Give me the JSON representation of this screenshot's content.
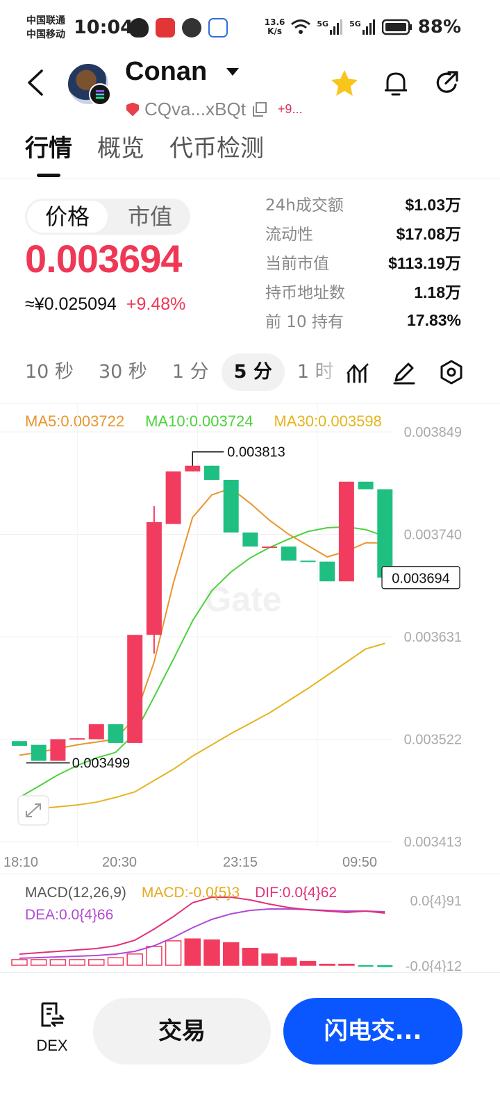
{
  "status_bar": {
    "carrier_1": "中国联通",
    "carrier_2": "中国移动",
    "time": "10:04",
    "net_speed_value": "13.6",
    "net_speed_unit": "K/s",
    "net_type_1": "5G",
    "net_type_2": "5G",
    "battery": "88%",
    "app_icons": [
      "qq-icon",
      "app-badge-icon",
      "message-icon",
      "mail-icon"
    ]
  },
  "header": {
    "token_name": "Conan",
    "address": "CQva...xBQt",
    "address_change": "+9..."
  },
  "tabs": [
    {
      "label": "行情",
      "active": true
    },
    {
      "label": "概览",
      "active": false
    },
    {
      "label": "代币检测",
      "active": false
    }
  ],
  "price_panel": {
    "toggle_price": "价格",
    "toggle_mcap": "市值",
    "price": "0.003694",
    "cny_price": "≈¥0.025094",
    "change": "+9.48%"
  },
  "stats": [
    {
      "label": "24h成交额",
      "value": "$1.03万"
    },
    {
      "label": "流动性",
      "value": "$17.08万"
    },
    {
      "label": "当前市值",
      "value": "$113.19万"
    },
    {
      "label": "持币地址数",
      "value": "1.18万"
    },
    {
      "label": "前 10 持有",
      "value": "17.83%"
    }
  ],
  "intervals": [
    {
      "label": "10 秒",
      "active": false
    },
    {
      "label": "30 秒",
      "active": false
    },
    {
      "label": "1 分",
      "active": false
    },
    {
      "label": "5 分",
      "active": true
    },
    {
      "label": "1 时",
      "active": false
    }
  ],
  "ma_legend": {
    "ma5": "MA5:0.003722",
    "ma10": "MA10:0.003724",
    "ma30": "MA30:0.003598",
    "ma5_color": "#e8952c",
    "ma10_color": "#4cd23c",
    "ma30_color": "#e5b41c"
  },
  "chart_data": {
    "type": "candlestick",
    "y_ticks": [
      "0.003849",
      "0.003740",
      "0.003631",
      "0.003522",
      "0.003413"
    ],
    "ylim": [
      0.003413,
      0.003849
    ],
    "x_ticks": [
      "18:10",
      "20:30",
      "23:15",
      "09:50"
    ],
    "watermark": "Gate",
    "high_label": "0.003813",
    "low_label": "0.003499",
    "current_label": "0.003694",
    "up_color": "#f23c5f",
    "down_color": "#1fbf81",
    "candles": [
      {
        "open": 0.00352,
        "close": 0.003515,
        "high": 0.00352,
        "low": 0.003515
      },
      {
        "open": 0.003516,
        "close": 0.003499,
        "high": 0.003516,
        "low": 0.003499
      },
      {
        "open": 0.003499,
        "close": 0.003522,
        "high": 0.003522,
        "low": 0.003499
      },
      {
        "open": 0.003522,
        "close": 0.003523,
        "high": 0.003523,
        "low": 0.003522
      },
      {
        "open": 0.003522,
        "close": 0.003538,
        "high": 0.003538,
        "low": 0.003522
      },
      {
        "open": 0.003538,
        "close": 0.003518,
        "high": 0.003538,
        "low": 0.003518
      },
      {
        "open": 0.003518,
        "close": 0.003633,
        "high": 0.003633,
        "low": 0.003518
      },
      {
        "open": 0.003633,
        "close": 0.003753,
        "high": 0.00377,
        "low": 0.003613
      },
      {
        "open": 0.003751,
        "close": 0.003807,
        "high": 0.003807,
        "low": 0.003751
      },
      {
        "open": 0.003807,
        "close": 0.003813,
        "high": 0.003813,
        "low": 0.003807
      },
      {
        "open": 0.003813,
        "close": 0.003798,
        "high": 0.003813,
        "low": 0.003798
      },
      {
        "open": 0.003798,
        "close": 0.003742,
        "high": 0.003798,
        "low": 0.003742
      },
      {
        "open": 0.003742,
        "close": 0.003727,
        "high": 0.003742,
        "low": 0.003727
      },
      {
        "open": 0.003727,
        "close": 0.003727,
        "high": 0.003727,
        "low": 0.003727
      },
      {
        "open": 0.003727,
        "close": 0.003712,
        "high": 0.003727,
        "low": 0.003712
      },
      {
        "open": 0.003712,
        "close": 0.003711,
        "high": 0.003712,
        "low": 0.003711
      },
      {
        "open": 0.003711,
        "close": 0.00369,
        "high": 0.003711,
        "low": 0.00369
      },
      {
        "open": 0.00369,
        "close": 0.003796,
        "high": 0.003796,
        "low": 0.00369
      },
      {
        "open": 0.003796,
        "close": 0.003788,
        "high": 0.003796,
        "low": 0.003788
      },
      {
        "open": 0.003788,
        "close": 0.003694,
        "high": 0.003788,
        "low": 0.003694
      }
    ],
    "ma5": [
      0.003505,
      0.003508,
      0.003512,
      0.003516,
      0.003519,
      0.003522,
      0.003545,
      0.003604,
      0.003688,
      0.003758,
      0.003782,
      0.003789,
      0.003773,
      0.003755,
      0.00374,
      0.003728,
      0.003716,
      0.003722,
      0.003731,
      0.003731
    ],
    "ma10": [
      0.00346,
      0.003472,
      0.003484,
      0.003494,
      0.003502,
      0.003508,
      0.003528,
      0.003567,
      0.003607,
      0.003648,
      0.00368,
      0.0037,
      0.003715,
      0.003726,
      0.003735,
      0.003743,
      0.003747,
      0.003748,
      0.003745,
      0.003738
    ],
    "ma30": [
      0.003448,
      0.003448,
      0.00345,
      0.003452,
      0.003455,
      0.00346,
      0.003466,
      0.003478,
      0.00349,
      0.003504,
      0.003516,
      0.003528,
      0.003539,
      0.00355,
      0.003563,
      0.003576,
      0.00359,
      0.003604,
      0.003618,
      0.003624
    ]
  },
  "macd": {
    "label": "MACD(12,26,9)",
    "macd_value": "MACD:-0.0{5}3",
    "dif_value": "DIF:0.0{4}62",
    "dea_value": "DEA:0.0{4}66",
    "axis_top": "0.0{4}91",
    "axis_bottom": "-0.0{4}12",
    "macd_color": "#e5a91c",
    "dif_color": "#e0317a",
    "dea_color": "#b14ad6"
  },
  "bottom_bar": {
    "dex_label": "DEX",
    "trade_label": "交易",
    "flash_label": "闪电交..."
  }
}
